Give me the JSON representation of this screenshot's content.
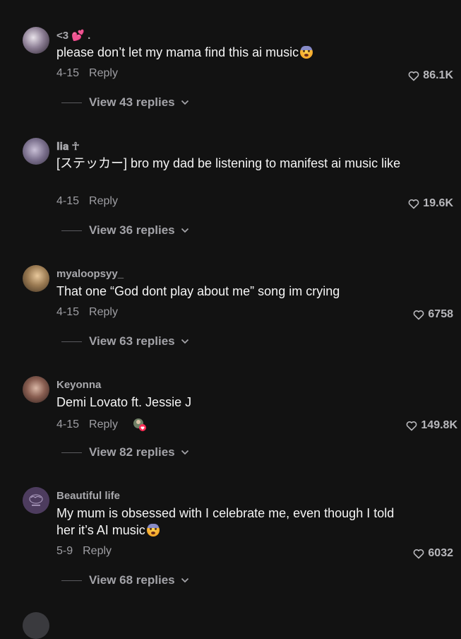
{
  "comments": [
    {
      "username": "<3 💕 .",
      "text": "please don’t let my mama find this ai music",
      "date": "4-15",
      "reply_label": "Reply",
      "likes": "86.1K",
      "view_replies": "View 43 replies"
    },
    {
      "username": "𝐈𝐢𝐚 ☥",
      "text": "[ステッカー] bro my dad be listening to manifest ai music like",
      "date": "4-15",
      "reply_label": "Reply",
      "likes": "19.6K",
      "view_replies": "View 36 replies"
    },
    {
      "username": "myaloopsyy_",
      "text": "That one “God dont play about me” song im crying",
      "date": "4-15",
      "reply_label": "Reply",
      "likes": "6758",
      "view_replies": "View 63 replies"
    },
    {
      "username": "Keyonna",
      "text": "Demi Lovato ft. Jessie J",
      "date": "4-15",
      "reply_label": "Reply",
      "likes": "149.8K",
      "view_replies": "View 82 replies"
    },
    {
      "username": "Beautiful life",
      "text": "My mum is obsessed with I celebrate me, even though I told her it’s AI music",
      "date": "5-9",
      "reply_label": "Reply",
      "likes": "6032",
      "view_replies": "View 68 replies"
    }
  ],
  "colors": {
    "background": "#121212",
    "muted_text": "#9e9ea3",
    "body_text": "#f5f5f5"
  },
  "icons": [
    "heart-outline-icon",
    "chevron-down-icon",
    "crying-face-emoji",
    "creator-liked-badge"
  ]
}
